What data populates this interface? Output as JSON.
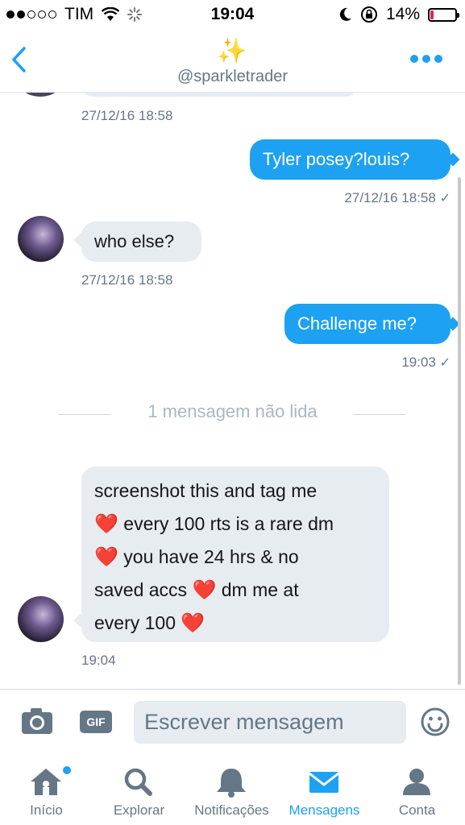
{
  "status_bar": {
    "carrier": "TIM",
    "time": "19:04",
    "battery": "14%",
    "battery_level": 0.14
  },
  "header": {
    "handle": "@sparkletrader",
    "badge_icon": "star-badge-icon"
  },
  "messages": {
    "prev_ts": "27/12/16 18:58",
    "m1_text": "Tyler posey?louis?",
    "m1_ts": "27/12/16 18:58",
    "m2_text": "who else?",
    "m2_ts": "27/12/16 18:58",
    "m3_text": "Challenge me?",
    "m3_ts": "19:03",
    "unread_divider": "1 mensagem não lida",
    "m4_lines": {
      "l1": "screenshot this and tag me",
      "l2": "every 100 rts is a rare dm",
      "l3": "you have 24 hrs & no",
      "l4": "saved accs",
      "l4b": "dm me at",
      "l5": "every 100",
      "heart": "❤️"
    },
    "m4_ts": "19:04",
    "read_check": "✓"
  },
  "composer": {
    "placeholder": "Escrever mensagem",
    "gif_label": "GIF"
  },
  "tabs": {
    "home": "Início",
    "explore": "Explorar",
    "notifications": "Notificações",
    "messages": "Mensagens",
    "account": "Conta"
  },
  "colors": {
    "accent": "#1da1f2",
    "bubble_in": "#e6ecf0",
    "muted": "#657786",
    "heart": "#e0245e"
  }
}
